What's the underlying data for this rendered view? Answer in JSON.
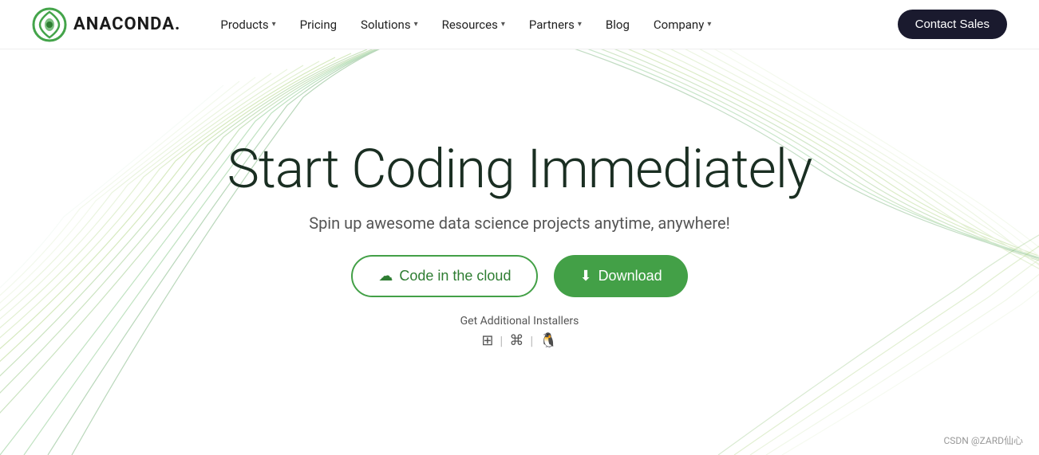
{
  "nav": {
    "logo_text": "ANACONDA.",
    "items": [
      {
        "label": "Products",
        "has_dropdown": true
      },
      {
        "label": "Pricing",
        "has_dropdown": false
      },
      {
        "label": "Solutions",
        "has_dropdown": true
      },
      {
        "label": "Resources",
        "has_dropdown": true
      },
      {
        "label": "Partners",
        "has_dropdown": true
      },
      {
        "label": "Blog",
        "has_dropdown": false
      },
      {
        "label": "Company",
        "has_dropdown": true
      }
    ],
    "contact_button": "Contact Sales"
  },
  "hero": {
    "title": "Start Coding Immediately",
    "subtitle": "Spin up awesome data science projects anytime, anywhere!",
    "btn_cloud": "Code in the cloud",
    "btn_download": "Download",
    "additional_label": "Get Additional Installers"
  },
  "watermark": {
    "text": "CSDN @ZARD仙心"
  }
}
